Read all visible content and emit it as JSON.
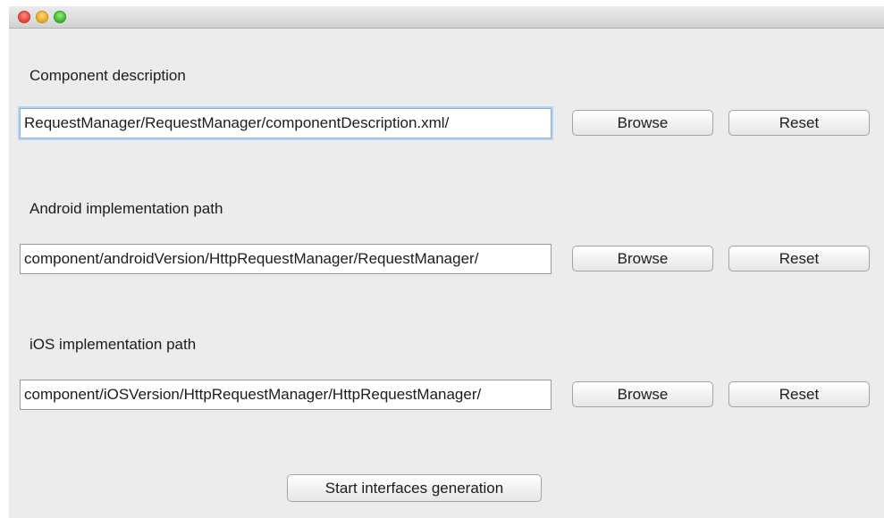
{
  "window": {
    "controls": {
      "close": "close-icon",
      "minimize": "minimize-icon",
      "zoom": "zoom-icon"
    }
  },
  "sections": [
    {
      "label": "Component description",
      "path_value": "/RequestManager/RequestManager/componentDescription.xml",
      "browse_label": "Browse",
      "reset_label": "Reset"
    },
    {
      "label": "Android implementation path",
      "path_value": "/component/androidVersion/HttpRequestManager/RequestManager",
      "browse_label": "Browse",
      "reset_label": "Reset"
    },
    {
      "label": "iOS implementation path",
      "path_value": "/component/iOSVersion/HttpRequestManager/HttpRequestManager",
      "browse_label": "Browse",
      "reset_label": "Reset"
    }
  ],
  "start_button_label": "Start interfaces generation",
  "colors": {
    "window_background": "#ececec",
    "focus_ring": "#b8d3f0"
  }
}
